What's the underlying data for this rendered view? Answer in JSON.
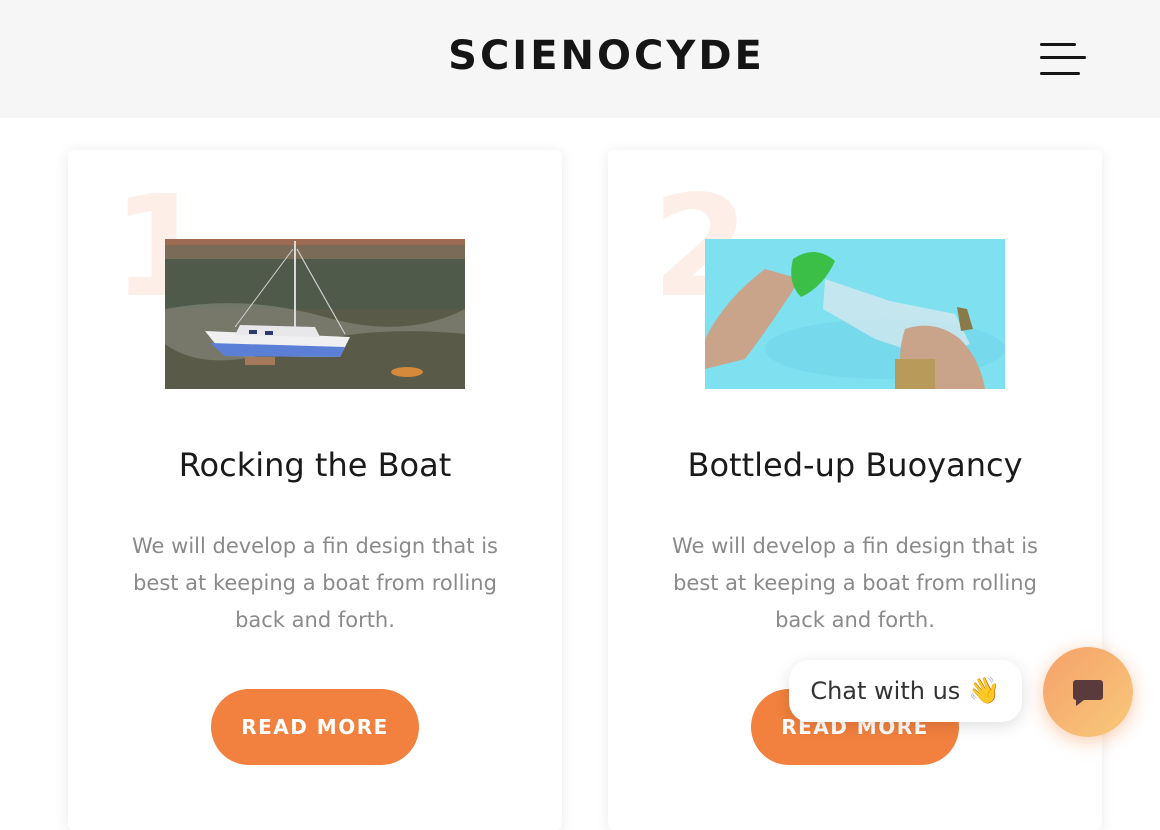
{
  "header": {
    "brand": "SCIENOCYDE",
    "menu_icon": "hamburger-menu-icon"
  },
  "cards": [
    {
      "number": "1",
      "title": "Rocking the Boat",
      "description": "We will develop a fin design that is best at keeping a boat from rolling back and forth.",
      "button_label": "READ MORE"
    },
    {
      "number": "2",
      "title": "Bottled-up Buoyancy",
      "description": "We will develop a fin design that is best at keeping a boat from rolling back and forth.",
      "button_label": "READ MORE"
    }
  ],
  "chat": {
    "label": "Chat with us",
    "wave": "👋",
    "button_icon": "chat-bubble-icon"
  },
  "colors": {
    "accent": "#f2803e",
    "header_bg": "#f6f6f6",
    "number_tint": "#fdeee8"
  }
}
